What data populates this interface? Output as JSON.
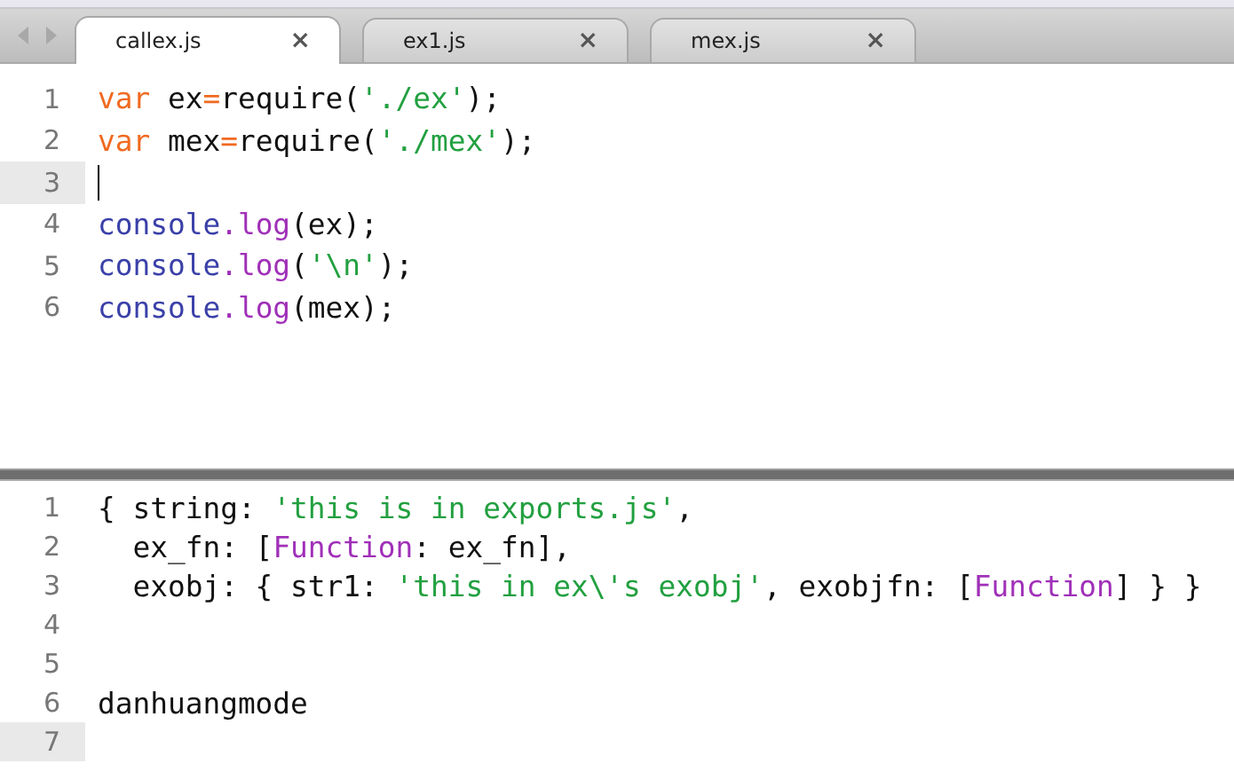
{
  "tabs": [
    {
      "label": "callex.js",
      "close": "×",
      "selected": true
    },
    {
      "label": "ex1.js",
      "close": "×",
      "selected": false
    },
    {
      "label": "mex.js",
      "close": "×",
      "selected": false
    }
  ],
  "editor": {
    "lines": [
      {
        "number": "1",
        "current": false,
        "tokens": [
          {
            "kind": "keyword",
            "text": "var"
          },
          {
            "kind": "plain",
            "text": " ex"
          },
          {
            "kind": "operator",
            "text": "="
          },
          {
            "kind": "plain",
            "text": "require("
          },
          {
            "kind": "string",
            "text": "'./ex'"
          },
          {
            "kind": "plain",
            "text": ");"
          }
        ]
      },
      {
        "number": "2",
        "current": false,
        "tokens": [
          {
            "kind": "keyword",
            "text": "var"
          },
          {
            "kind": "plain",
            "text": " mex"
          },
          {
            "kind": "operator",
            "text": "="
          },
          {
            "kind": "plain",
            "text": "require("
          },
          {
            "kind": "string",
            "text": "'./mex'"
          },
          {
            "kind": "plain",
            "text": ");"
          }
        ]
      },
      {
        "number": "3",
        "current": true
      },
      {
        "number": "4",
        "current": false,
        "tokens": [
          {
            "kind": "builtin",
            "text": "console"
          },
          {
            "kind": "method",
            "text": ".log"
          },
          {
            "kind": "plain",
            "text": "(ex);"
          }
        ]
      },
      {
        "number": "5",
        "current": false,
        "tokens": [
          {
            "kind": "builtin",
            "text": "console"
          },
          {
            "kind": "method",
            "text": ".log"
          },
          {
            "kind": "plain",
            "text": "("
          },
          {
            "kind": "string",
            "text": "'\\n'"
          },
          {
            "kind": "plain",
            "text": ");"
          }
        ]
      },
      {
        "number": "6",
        "current": false,
        "tokens": [
          {
            "kind": "builtin",
            "text": "console"
          },
          {
            "kind": "method",
            "text": ".log"
          },
          {
            "kind": "plain",
            "text": "(mex);"
          }
        ]
      }
    ]
  },
  "output": {
    "lines": [
      {
        "number": "1",
        "current": false,
        "tokens": [
          {
            "kind": "plain",
            "text": "{ string: "
          },
          {
            "kind": "string",
            "text": "'this is in exports.js'"
          },
          {
            "kind": "plain",
            "text": ","
          }
        ]
      },
      {
        "number": "2",
        "current": false,
        "tokens": [
          {
            "kind": "plain",
            "text": "  ex_fn: ["
          },
          {
            "kind": "method",
            "text": "Function"
          },
          {
            "kind": "plain",
            "text": ": ex_fn],"
          }
        ]
      },
      {
        "number": "3",
        "current": false,
        "tokens": [
          {
            "kind": "plain",
            "text": "  exobj: { str1: "
          },
          {
            "kind": "string",
            "text": "'this in ex\\'s exobj'"
          },
          {
            "kind": "plain",
            "text": ", exobjfn: ["
          },
          {
            "kind": "method",
            "text": "Function"
          },
          {
            "kind": "plain",
            "text": "] } }"
          }
        ]
      },
      {
        "number": "4",
        "current": false
      },
      {
        "number": "5",
        "current": false
      },
      {
        "number": "6",
        "current": false,
        "tokens": [
          {
            "kind": "plain",
            "text": "danhuangmode"
          }
        ]
      },
      {
        "number": "7",
        "current": true
      }
    ]
  }
}
